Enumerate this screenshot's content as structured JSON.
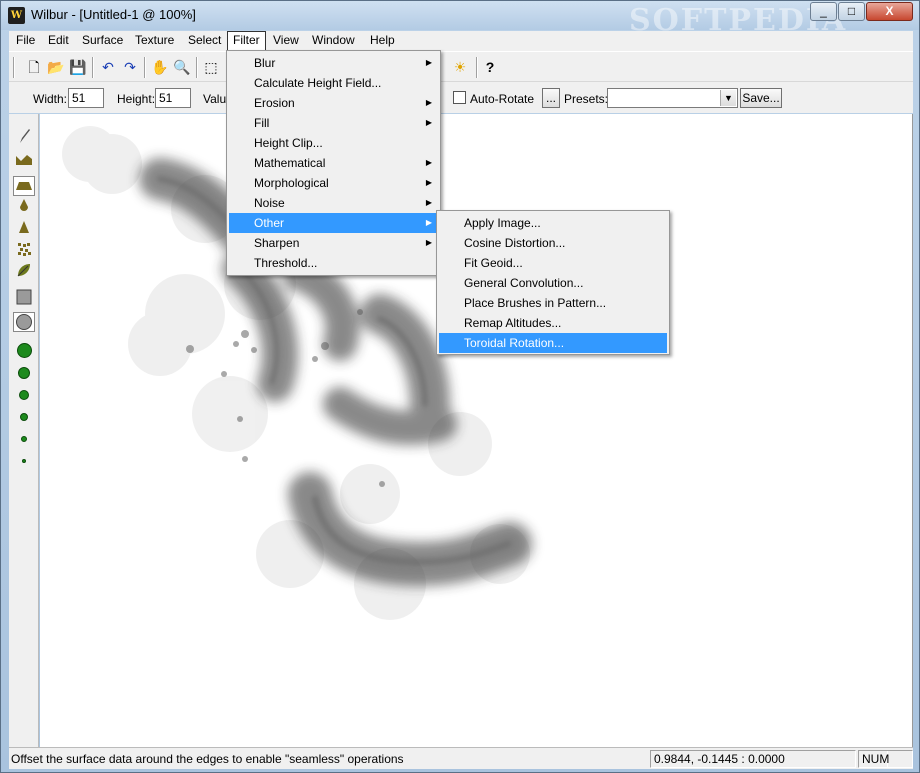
{
  "window": {
    "title": "Wilbur - [Untitled-1 @ 100%]",
    "icon_letter": "W",
    "watermark": "SOFTPEDIA"
  },
  "window_controls": {
    "minimize": "_",
    "maximize": "□",
    "close": "X"
  },
  "menubar": [
    "File",
    "Edit",
    "Surface",
    "Texture",
    "Select",
    "Filter",
    "View",
    "Window",
    "Help"
  ],
  "toolbar": {
    "icons": [
      "new-icon",
      "open-icon",
      "save-icon",
      "undo-icon",
      "redo-icon",
      "hand-icon",
      "zoom-icon",
      "select-rect-icon",
      "sun-icon",
      "help-icon"
    ],
    "glyphs": [
      "🗋",
      "📂",
      "💾",
      "↶",
      "↷",
      "✋",
      "🔍",
      "⬚",
      "☀",
      "?"
    ]
  },
  "options": {
    "width_label": "Width:",
    "width_value": "51",
    "height_label": "Height:",
    "height_value": "51",
    "value_label": "Valu",
    "auto_rotate_label": "Auto-Rotate",
    "browse_label": "...",
    "presets_label": "Presets:",
    "presets_value": "",
    "save_label": "Save..."
  },
  "filter_menu": [
    "Blur",
    "Calculate Height Field...",
    "Erosion",
    "Fill",
    "Height Clip...",
    "Mathematical",
    "Morphological",
    "Noise",
    "Other",
    "Sharpen",
    "Threshold..."
  ],
  "other_submenu": [
    "Apply Image...",
    "Cosine Distortion...",
    "Fit Geoid...",
    "General Convolution...",
    "Place Brushes in Pattern...",
    "Remap Altitudes...",
    "Toroidal Rotation..."
  ],
  "status": {
    "message": "Offset the surface data around the edges to enable \"seamless\" operations",
    "coords": "0.9844, -0.1445 : 0.0000",
    "num": "NUM"
  },
  "colors": {
    "highlight": "#3399ff",
    "brush": "#1d8a1d"
  }
}
